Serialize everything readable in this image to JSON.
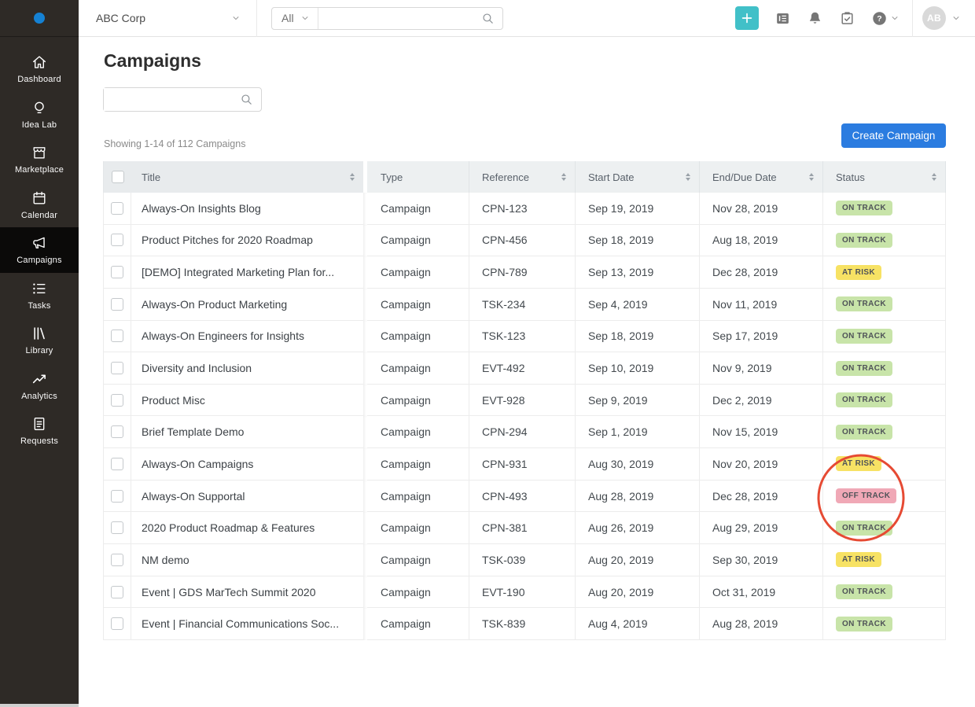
{
  "colors": {
    "logo_blue": "#1581d3",
    "accent_teal": "#41c0c8",
    "primary_blue": "#2b7ce0",
    "annotation_red": "#e64a33",
    "sidebar_bg": "#2e2a26",
    "sidebar_active_bg": "#0b0a09",
    "status": {
      "ON TRACK": "#c8e4a9",
      "AT RISK": "#f7e264",
      "OFF TRACK": "#f0a8b6"
    }
  },
  "topbar": {
    "org_name": "ABC Corp",
    "search_scope": "All",
    "search_value": "",
    "avatar_initials": "AB"
  },
  "sidebar": {
    "items": [
      {
        "label": "Dashboard",
        "icon": "home",
        "active": false
      },
      {
        "label": "Idea Lab",
        "icon": "lightbulb",
        "active": false
      },
      {
        "label": "Marketplace",
        "icon": "storefront",
        "active": false
      },
      {
        "label": "Calendar",
        "icon": "calendar",
        "active": false
      },
      {
        "label": "Campaigns",
        "icon": "megaphone",
        "active": true
      },
      {
        "label": "Tasks",
        "icon": "list",
        "active": false
      },
      {
        "label": "Library",
        "icon": "library",
        "active": false
      },
      {
        "label": "Analytics",
        "icon": "trend",
        "active": false
      },
      {
        "label": "Requests",
        "icon": "document",
        "active": false
      }
    ]
  },
  "main": {
    "title": "Campaigns",
    "filter_value": "",
    "result_count": "Showing 1-14 of 112 Campaigns",
    "create_button_label": "Create Campaign"
  },
  "table": {
    "columns": {
      "title": "Title",
      "type": "Type",
      "reference": "Reference",
      "start": "Start Date",
      "end": "End/Due Date",
      "status": "Status"
    },
    "rows": [
      {
        "title": "Always-On Insights Blog",
        "type": "Campaign",
        "reference": "CPN-123",
        "start": "Sep 19, 2019",
        "end": "Nov 28, 2019",
        "status": "ON TRACK"
      },
      {
        "title": "Product Pitches for 2020 Roadmap",
        "type": "Campaign",
        "reference": "CPN-456",
        "start": "Sep 18, 2019",
        "end": "Aug 18, 2019",
        "status": "ON TRACK"
      },
      {
        "title": "[DEMO] Integrated Marketing Plan for...",
        "type": "Campaign",
        "reference": "CPN-789",
        "start": "Sep 13, 2019",
        "end": "Dec 28, 2019",
        "status": "AT RISK"
      },
      {
        "title": "Always-On Product Marketing",
        "type": "Campaign",
        "reference": "TSK-234",
        "start": "Sep 4, 2019",
        "end": "Nov 11, 2019",
        "status": "ON TRACK"
      },
      {
        "title": "Always-On Engineers for Insights",
        "type": "Campaign",
        "reference": "TSK-123",
        "start": "Sep 18, 2019",
        "end": "Sep 17, 2019",
        "status": "ON TRACK"
      },
      {
        "title": "Diversity and Inclusion",
        "type": "Campaign",
        "reference": "EVT-492",
        "start": "Sep 10, 2019",
        "end": "Nov 9, 2019",
        "status": "ON TRACK"
      },
      {
        "title": "Product Misc",
        "type": "Campaign",
        "reference": "EVT-928",
        "start": "Sep 9, 2019",
        "end": "Dec 2, 2019",
        "status": "ON TRACK"
      },
      {
        "title": "Brief Template Demo",
        "type": "Campaign",
        "reference": "CPN-294",
        "start": "Sep 1, 2019",
        "end": "Nov 15, 2019",
        "status": "ON TRACK"
      },
      {
        "title": "Always-On Campaigns",
        "type": "Campaign",
        "reference": "CPN-931",
        "start": "Aug 30, 2019",
        "end": "Nov 20, 2019",
        "status": "AT RISK"
      },
      {
        "title": "Always-On Supportal",
        "type": "Campaign",
        "reference": "CPN-493",
        "start": "Aug 28, 2019",
        "end": "Dec 28, 2019",
        "status": "OFF TRACK"
      },
      {
        "title": "2020 Product Roadmap & Features",
        "type": "Campaign",
        "reference": "CPN-381",
        "start": "Aug 26, 2019",
        "end": "Aug 29, 2019",
        "status": "ON TRACK"
      },
      {
        "title": "NM demo",
        "type": "Campaign",
        "reference": "TSK-039",
        "start": "Aug 20, 2019",
        "end": "Sep 30, 2019",
        "status": "AT RISK"
      },
      {
        "title": "Event | GDS MarTech Summit 2020",
        "type": "Campaign",
        "reference": "EVT-190",
        "start": "Aug 20, 2019",
        "end": "Oct 31, 2019",
        "status": "ON TRACK"
      },
      {
        "title": "Event | Financial Communications Soc...",
        "type": "Campaign",
        "reference": "TSK-839",
        "start": "Aug 4, 2019",
        "end": "Aug 28, 2019",
        "status": "ON TRACK"
      }
    ]
  },
  "annotation": {
    "shape": "circle"
  }
}
